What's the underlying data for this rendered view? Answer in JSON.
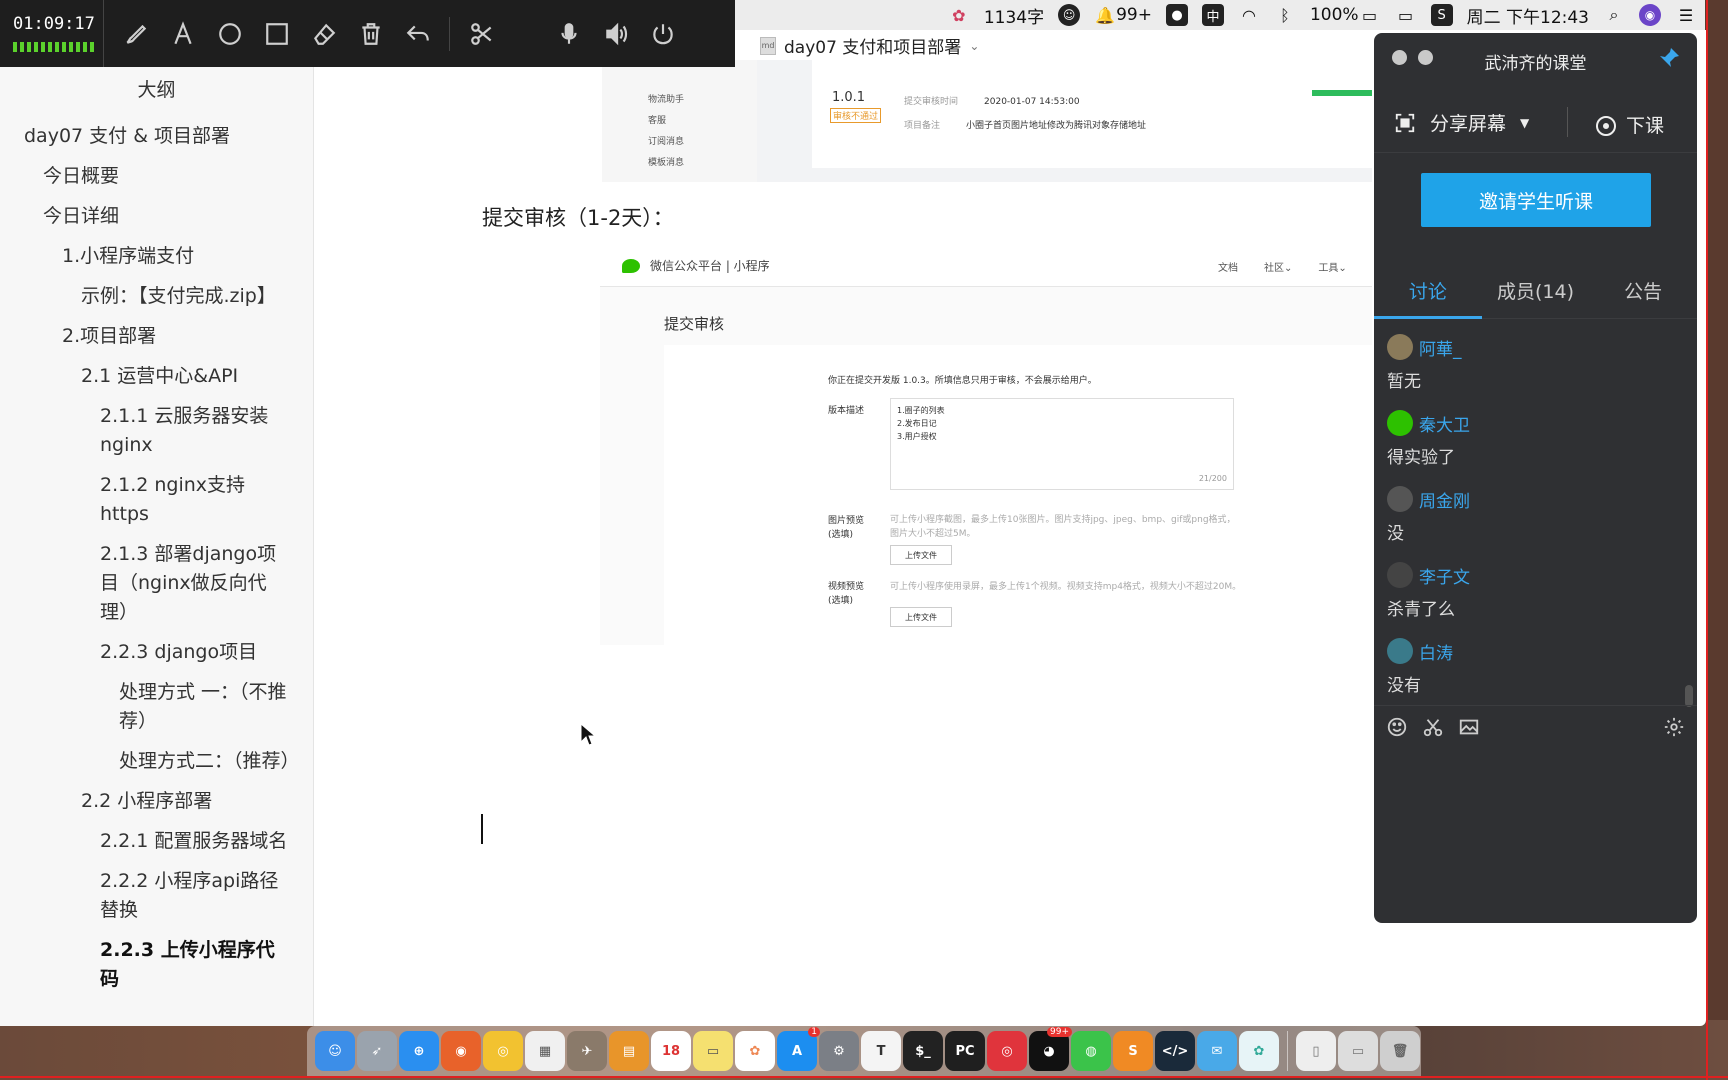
{
  "recorder": {
    "time": "01:09:17"
  },
  "menubar": {
    "word_count": "1134字",
    "qq_badge": "99+",
    "input_method": "中",
    "battery": "100%",
    "datetime": "周二 下午12:43"
  },
  "document": {
    "title": "day07 支付和项目部署",
    "outline_header": "大纲",
    "outline": [
      {
        "text": "day07 支付 & 项目部署",
        "level": 0
      },
      {
        "text": "今日概要",
        "level": 1
      },
      {
        "text": "今日详细",
        "level": 1
      },
      {
        "text": "1.小程序端支付",
        "level": 2
      },
      {
        "text": "示例：【支付完成.zip】",
        "level": 3
      },
      {
        "text": "2.项目部署",
        "level": 2
      },
      {
        "text": "2.1 运营中心&API",
        "level": 3
      },
      {
        "text": "2.1.1 云服务器安装nginx",
        "level": 4
      },
      {
        "text": "2.1.2 nginx支持https",
        "level": 4
      },
      {
        "text": "2.1.3 部署django项目（nginx做反向代理）",
        "level": 4
      },
      {
        "text": "2.2.3 django项目",
        "level": 4
      },
      {
        "text": "处理方式 一：（不推荐）",
        "level": 5
      },
      {
        "text": "处理方式二：（推荐）",
        "level": 5
      },
      {
        "text": "2.2 小程序部署",
        "level": 3
      },
      {
        "text": "2.2.1 配置服务器域名",
        "level": 4
      },
      {
        "text": "2.2.2 小程序api路径替换",
        "level": 4
      },
      {
        "text": "2.2.3 上传小程序代码",
        "level": 4,
        "active": true
      }
    ],
    "section_heading": "提交审核（1-2天）：",
    "top_image": {
      "side_items": [
        "物流助手",
        "客服",
        "订阅消息",
        "模板消息"
      ],
      "version": "1.0.1",
      "status_badge": "审核不通过",
      "submit_time_label": "提交审核时间",
      "submit_time": "2020-01-07 14:53:00",
      "remark_label": "项目备注",
      "remark": "小圈子首页图片地址修改为腾讯对象存储地址"
    },
    "review_image": {
      "platform": "微信公众平台 | 小程序",
      "nav": [
        "文档",
        "社区",
        "工具"
      ],
      "page_title": "提交审核",
      "notice": "你正在提交开发版 1.0.3。所填信息只用于审核，不会展示给用户。",
      "version_desc_label": "版本描述",
      "version_desc_lines": [
        "1.圈子的列表",
        "2.发布日记",
        "3.用户授权"
      ],
      "char_count": "21/200",
      "image_preview_label": "图片预览",
      "image_preview_optional": "(选填)",
      "image_preview_hint": "可上传小程序截图，最多上传10张图片。图片支持jpg、jpeg、bmp、gif或png格式，图片大小不超过5M。",
      "upload_label": "上传文件",
      "video_preview_label": "视频预览",
      "video_preview_optional": "(选填)",
      "video_preview_hint": "可上传小程序使用录屏，最多上传1个视频。视频支持mp4格式，视频大小不超过20M。"
    }
  },
  "classroom": {
    "title": "武沛齐的课堂",
    "share_screen": "分享屏幕",
    "end_class": "下课",
    "invite": "邀请学生听课",
    "tabs": [
      "讨论",
      "成员(14)",
      "公告"
    ],
    "messages": [
      {
        "name": "阿華_",
        "text": "暂无"
      },
      {
        "name": "秦大卫",
        "text": "得实验了"
      },
      {
        "name": "周金刚",
        "text": "没"
      },
      {
        "name": "李子文",
        "text": "杀青了么"
      },
      {
        "name": "白涛",
        "text": "没有"
      }
    ]
  },
  "dock": {
    "calendar_day": "18",
    "appstore_badge": "1",
    "qq_badge": "99+"
  },
  "colors": {
    "accent_blue": "#1fa3e8",
    "panel_bg": "#2f3033",
    "recorder_green": "#5bd22c",
    "recording_red": "#e02020"
  }
}
